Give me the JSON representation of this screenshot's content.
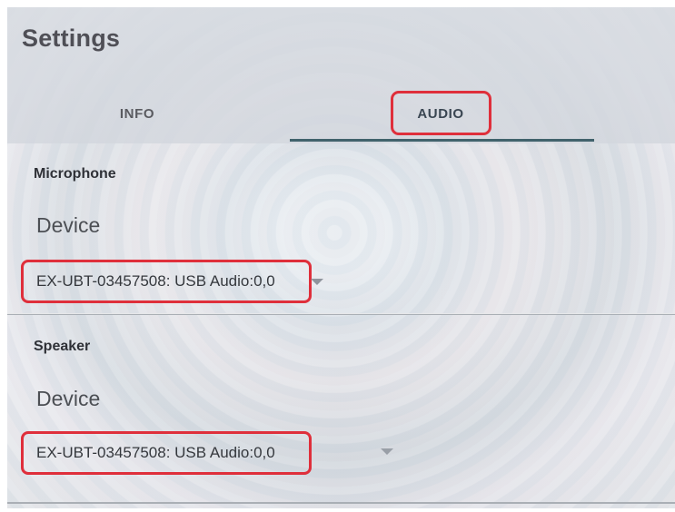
{
  "window": {
    "title": "Settings"
  },
  "tabs": [
    {
      "label": "INFO",
      "selected": false
    },
    {
      "label": "AUDIO",
      "selected": true
    }
  ],
  "sections": [
    {
      "title": "Microphone",
      "field_label": "Device",
      "selected_device": "EX-UBT-03457508: USB Audio:0,0"
    },
    {
      "title": "Speaker",
      "field_label": "Device",
      "selected_device": "EX-UBT-03457508: USB Audio:0,0"
    }
  ],
  "colors": {
    "annotation": "#df2f3b",
    "tab_indicator": "#31555f",
    "text_primary": "#35383d"
  },
  "icons": {
    "dropdown": "chevron-down-icon"
  }
}
